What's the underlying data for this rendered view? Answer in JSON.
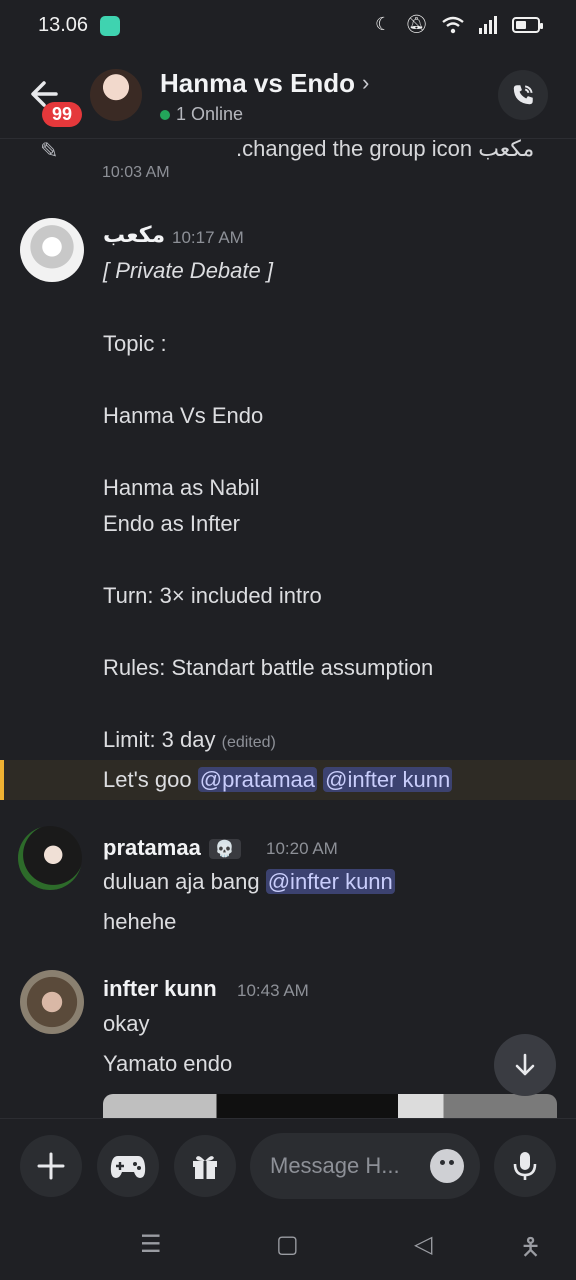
{
  "status": {
    "time": "13.06"
  },
  "header": {
    "back_badge": "99",
    "title": "Hanma vs Endo",
    "online_text": "1 Online"
  },
  "system_message": {
    "text": ".changed the group icon مكعب",
    "time": "10:03 AM"
  },
  "messages": [
    {
      "author": "مكعب",
      "time": "10:17 AM",
      "lines": [
        "[ Private Debate ]",
        "Topic :",
        "Hanma Vs Endo",
        "Hanma as Nabil",
        "Endo as Infter",
        "Turn: 3× included intro",
        "Rules: Standart battle assumption",
        "Limit: 3 day"
      ],
      "edited": "(edited)",
      "extra_line": "Let's goo",
      "mentions": [
        "@pratamaa",
        "@infter kunn"
      ]
    },
    {
      "author": "pratamaa",
      "badge": "💀",
      "time": "10:20 AM",
      "line1": "duluan aja bang",
      "mention": "@infter kunn",
      "line2": "hehehe"
    },
    {
      "author": "infter kunn",
      "time": "10:43 AM",
      "line1": "okay",
      "line2": "Yamato endo"
    }
  ],
  "composer": {
    "placeholder": "Message H..."
  }
}
